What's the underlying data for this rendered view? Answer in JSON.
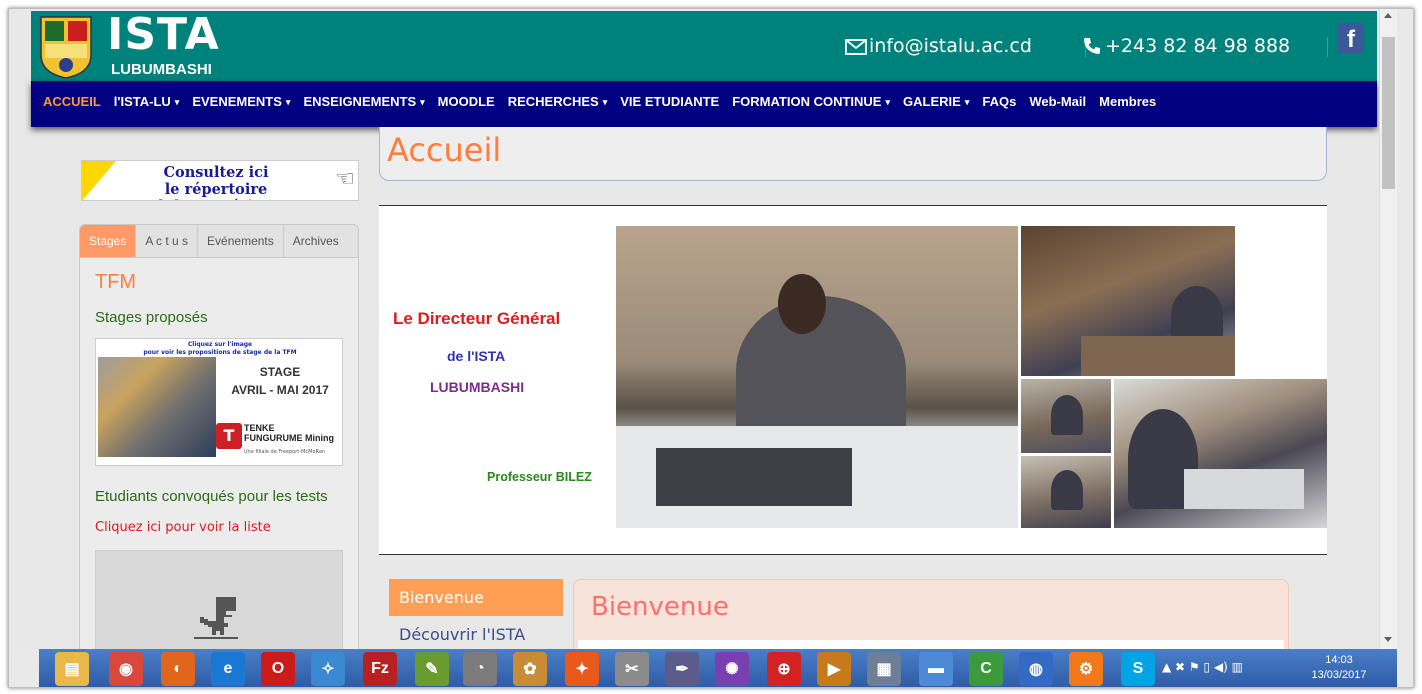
{
  "header": {
    "logo_title": "ISTA",
    "logo_subtitle": "LUBUMBASHI",
    "email": "info@istalu.ac.cd",
    "phone": "+243 82 84 98 888",
    "facebook_glyph": "f"
  },
  "nav": {
    "items": [
      {
        "label": "ACCUEIL",
        "dropdown": false,
        "active": true
      },
      {
        "label": "l'ISTA-LU",
        "dropdown": true
      },
      {
        "label": "EVENEMENTS",
        "dropdown": true
      },
      {
        "label": "ENSEIGNEMENTS",
        "dropdown": true
      },
      {
        "label": "MOODLE",
        "dropdown": false
      },
      {
        "label": "RECHERCHES",
        "dropdown": true
      },
      {
        "label": "VIE ETUDIANTE",
        "dropdown": false
      },
      {
        "label": "FORMATION CONTINUE",
        "dropdown": true
      },
      {
        "label": "GALERIE",
        "dropdown": true
      },
      {
        "label": "FAQs",
        "dropdown": false
      },
      {
        "label": "Web-Mail",
        "dropdown": false
      },
      {
        "label": "Membres",
        "dropdown": false
      }
    ],
    "caret": "▾"
  },
  "sidebar": {
    "banner_line1": "Consultez ici",
    "banner_line2": "le répertoire alphanumérique",
    "tabs": [
      "Stages",
      "A c t u s",
      "Evénements",
      "Archives"
    ],
    "tfm_title": "TFM",
    "stages_link": "Stages proposés",
    "stage_image": {
      "caption_line1": "Cliquez sur l'image",
      "caption_line2": "pour voir les propositions de stage de la TFM",
      "title_line1": "STAGE",
      "title_line2": "AVRIL - MAI 2017",
      "logo_mark": "T",
      "logo_line1": "TENKE",
      "logo_line2": "FUNGURUME Mining",
      "logo_sub": "Une filiale de Freeport-McMoRan"
    },
    "convoques_title": "Etudiants convoqués pour les tests",
    "voir_liste_link": "Cliquez ici pour voir la liste"
  },
  "main": {
    "page_title": "Accueil",
    "hero": {
      "line1": "Le Directeur Général",
      "line2": "de l'ISTA",
      "line3": "LUBUMBASHI",
      "prof": "Professeur BILEZ"
    },
    "side_tabs": [
      "Bienvenue",
      "Découvrir l'ISTA"
    ],
    "welcome_title": "Bienvenue"
  },
  "taskbar": {
    "icons": [
      {
        "name": "file-explorer-icon",
        "glyph": "▤",
        "color": "#e8b84a"
      },
      {
        "name": "chrome-icon",
        "glyph": "◉",
        "color": "#d9493b"
      },
      {
        "name": "firefox-icon",
        "glyph": "◐",
        "color": "#e0651d"
      },
      {
        "name": "internet-explorer-icon",
        "glyph": "e",
        "color": "#1a78d2"
      },
      {
        "name": "opera-icon",
        "glyph": "O",
        "color": "#cc1b1b"
      },
      {
        "name": "safari-icon",
        "glyph": "✧",
        "color": "#3b8ad1"
      },
      {
        "name": "filezilla-icon",
        "glyph": "Fz",
        "color": "#b62222"
      },
      {
        "name": "notepad-plus-icon",
        "glyph": "✎",
        "color": "#6a9b2e"
      },
      {
        "name": "gauge-icon",
        "glyph": "◔",
        "color": "#7b7b7b"
      },
      {
        "name": "paint-icon",
        "glyph": "✿",
        "color": "#c98b36"
      },
      {
        "name": "pdf-reader-icon",
        "glyph": "✦",
        "color": "#e85a1c"
      },
      {
        "name": "snipping-tool-icon",
        "glyph": "✂",
        "color": "#8b8b8b"
      },
      {
        "name": "tools-icon",
        "glyph": "✒",
        "color": "#5b5b8c"
      },
      {
        "name": "picasa-icon",
        "glyph": "✺",
        "color": "#7a3fb0"
      },
      {
        "name": "web-globe-icon",
        "glyph": "⊕",
        "color": "#d32222"
      },
      {
        "name": "media-player-icon",
        "glyph": "▶",
        "color": "#c77a1b"
      },
      {
        "name": "calculator-icon",
        "glyph": "▦",
        "color": "#6c7f97"
      },
      {
        "name": "notes-icon",
        "glyph": "▬",
        "color": "#4d8ad6"
      },
      {
        "name": "camtasia-icon",
        "glyph": "C",
        "color": "#3b9a3b"
      },
      {
        "name": "google-earth-icon",
        "glyph": "◍",
        "color": "#3469c4"
      },
      {
        "name": "xampp-icon",
        "glyph": "⚙",
        "color": "#f07a1b"
      },
      {
        "name": "skype-icon",
        "glyph": "S",
        "color": "#00a4e4"
      }
    ],
    "tray_text": "▲ ✖ ⚑ ▯ ◀) ▥",
    "time": "14:03",
    "date": "13/03/2017"
  }
}
